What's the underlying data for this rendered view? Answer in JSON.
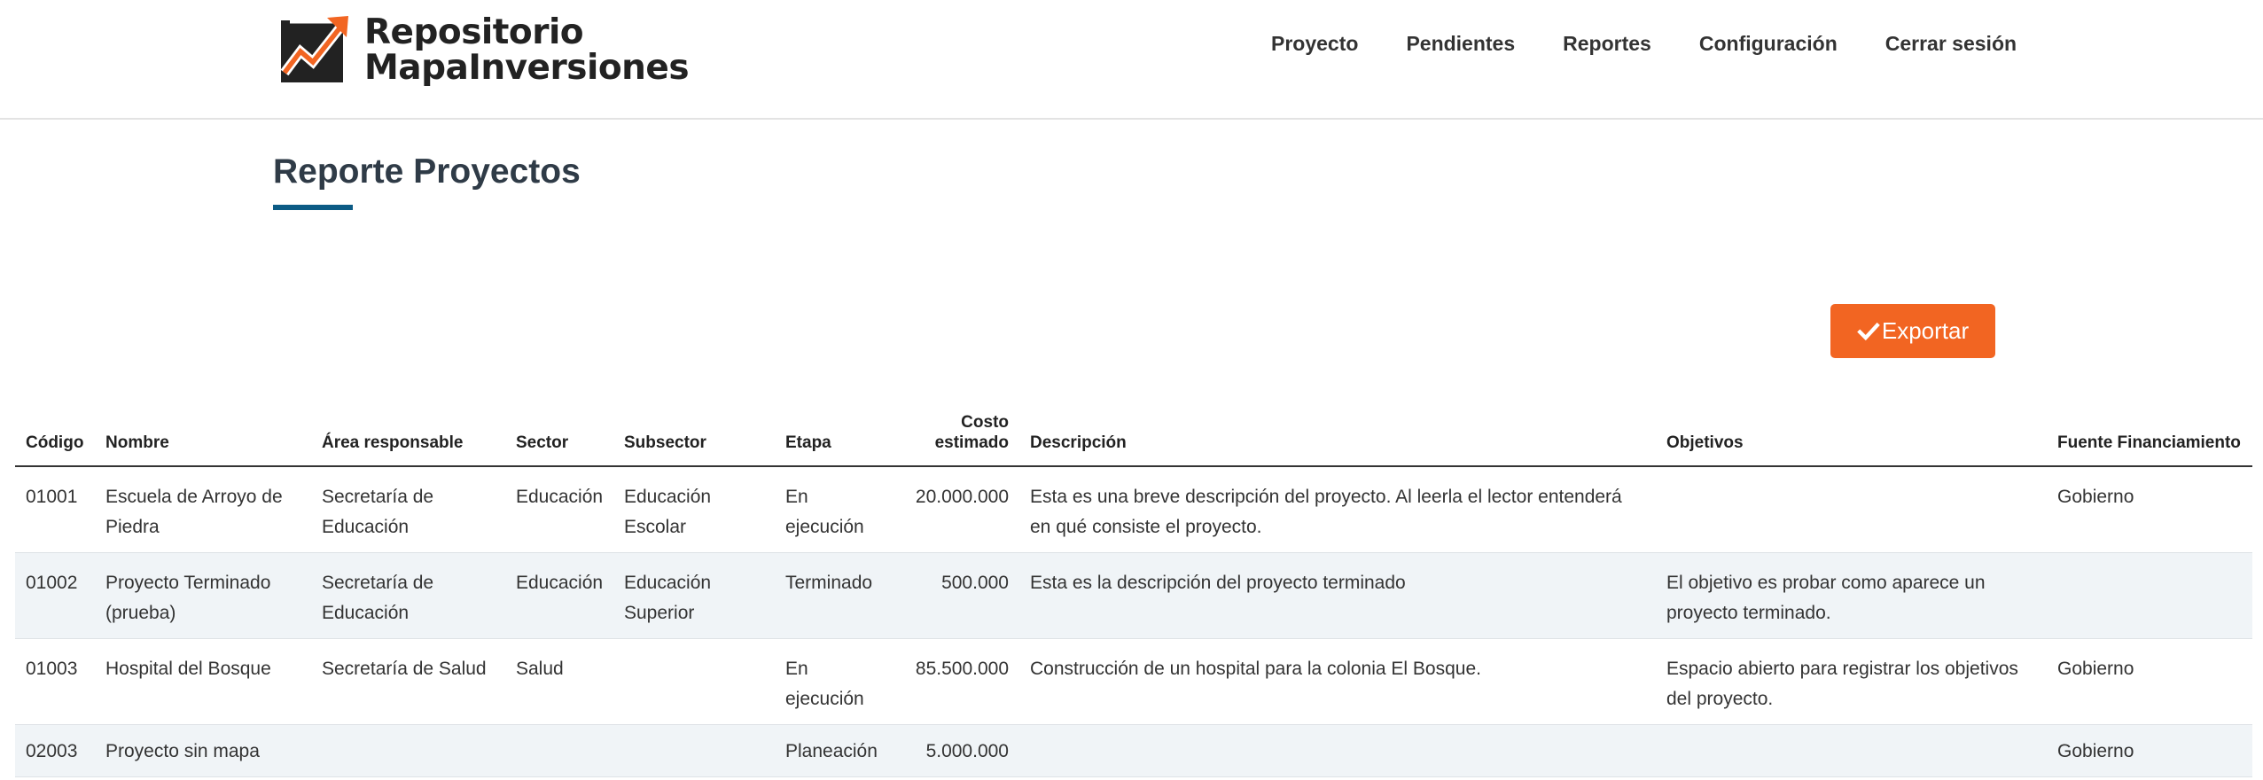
{
  "brand": {
    "line1": "Repositorio",
    "line2": "MapaInversiones",
    "colors": {
      "mark_bg": "#222222",
      "mark_arrow": "#f26522"
    }
  },
  "nav": {
    "items": [
      "Proyecto",
      "Pendientes",
      "Reportes",
      "Configuración",
      "Cerrar sesión"
    ]
  },
  "page": {
    "title": "Reporte Proyectos",
    "accent_color": "#0c5b85"
  },
  "export_button": {
    "label": "Exportar",
    "icon": "check-icon",
    "color": "#f26522"
  },
  "table": {
    "headers": {
      "codigo": "Código",
      "nombre": "Nombre",
      "area": "Área responsable",
      "sector": "Sector",
      "subsector": "Subsector",
      "etapa": "Etapa",
      "costo": "Costo estimado",
      "descripcion": "Descripción",
      "objetivos": "Objetivos",
      "fuente": "Fuente Financiamiento"
    },
    "rows": [
      {
        "codigo": "01001",
        "nombre": "Escuela de Arroyo de Piedra",
        "area": "Secretaría de Educación",
        "sector": "Educación",
        "subsector": "Educación Escolar",
        "etapa": "En ejecución",
        "costo": "20.000.000",
        "descripcion": "Esta es una breve descripción del proyecto. Al leerla el lector entenderá en qué consiste el proyecto.",
        "objetivos": "",
        "fuente": "Gobierno"
      },
      {
        "codigo": "01002",
        "nombre": "Proyecto Terminado (prueba)",
        "area": "Secretaría de Educación",
        "sector": "Educación",
        "subsector": "Educación Superior",
        "etapa": "Terminado",
        "costo": "500.000",
        "descripcion": "Esta es la descripción del proyecto terminado",
        "objetivos": "El objetivo es probar como aparece un proyecto terminado.",
        "fuente": ""
      },
      {
        "codigo": "01003",
        "nombre": "Hospital del Bosque",
        "area": "Secretaría de Salud",
        "sector": "Salud",
        "subsector": "",
        "etapa": "En ejecución",
        "costo": "85.500.000",
        "descripcion": "Construcción de un hospital para la colonia El Bosque.",
        "objetivos": "Espacio abierto para registrar los objetivos del proyecto.",
        "fuente": "Gobierno"
      },
      {
        "codigo": "02003",
        "nombre": "Proyecto sin mapa",
        "area": "",
        "sector": "",
        "subsector": "",
        "etapa": "Planeación",
        "costo": "5.000.000",
        "descripcion": "",
        "objetivos": "",
        "fuente": "Gobierno"
      }
    ]
  }
}
